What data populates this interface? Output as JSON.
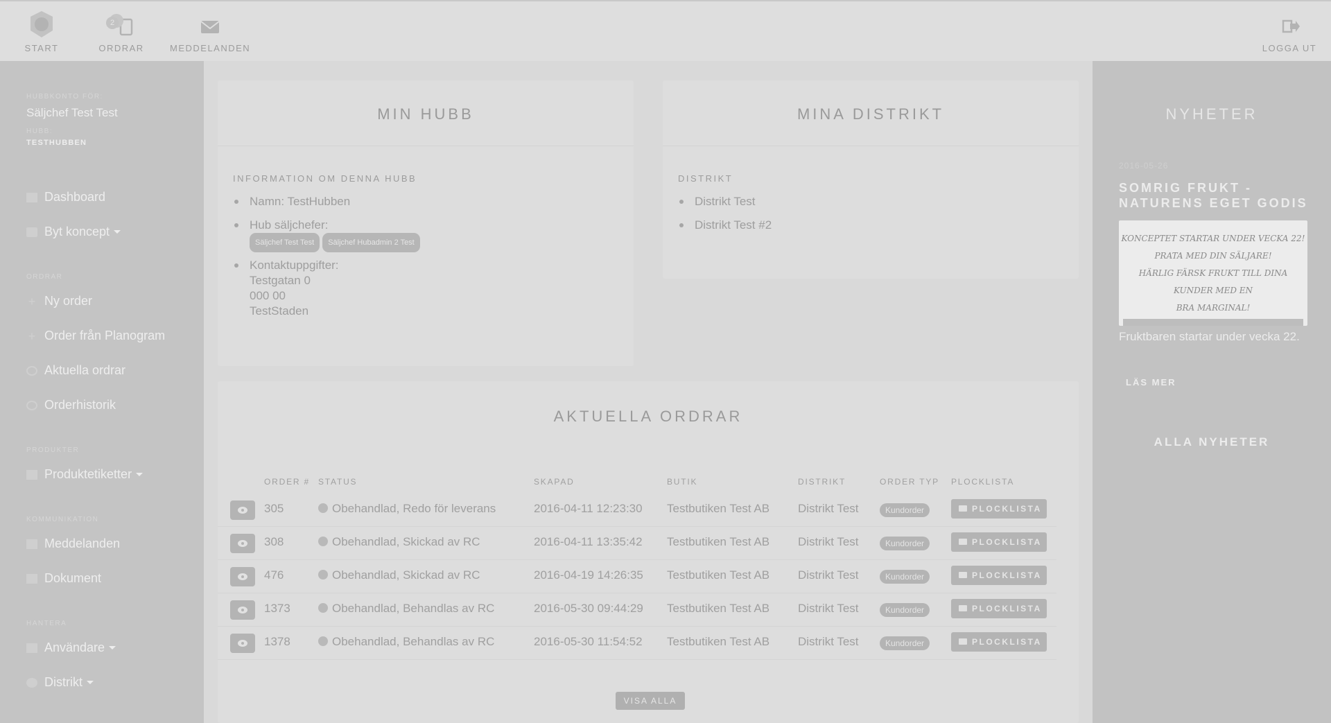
{
  "nav": {
    "start": "START",
    "ordrar": "ORDRAR",
    "ordrar_badge": "2",
    "meddelanden": "MEDDELANDEN",
    "logout": "LOGGA UT"
  },
  "sidebar": {
    "account_label": "HUBBKONTO FÖR:",
    "account_name": "Säljchef Test Test",
    "hub_label": "HUBB:",
    "hub_name": "TESTHUBBEN",
    "items": {
      "dashboard": "Dashboard",
      "byt_koncept": "Byt koncept",
      "section_ordrar": "ORDRAR",
      "ny_order": "Ny order",
      "order_planogram": "Order från Planogram",
      "aktuella": "Aktuella ordrar",
      "historik": "Orderhistorik",
      "section_produkter": "PRODUKTER",
      "produktetiketter": "Produktetiketter",
      "section_kommunikation": "KOMMUNIKATION",
      "meddelanden": "Meddelanden",
      "dokument": "Dokument",
      "section_hantera": "HANTERA",
      "anvandare": "Användare",
      "distrikt": "Distrikt"
    }
  },
  "min_hubb": {
    "title": "MIN HUBB",
    "info_head": "INFORMATION OM DENNA HUBB",
    "namn": "Namn: TestHubben",
    "saljchefer_label": "Hub säljchefer:",
    "saljchefer": [
      "Säljchef Test Test",
      "Säljchef Hubadmin 2 Test"
    ],
    "kontakt_label": "Kontaktuppgifter:",
    "kontakt_street": "Testgatan 0",
    "kontakt_zip": "000 00",
    "kontakt_city": "TestStaden"
  },
  "mina_distrikt": {
    "title": "MINA DISTRIKT",
    "head": "DISTRIKT",
    "items": [
      "Distrikt Test",
      "Distrikt Test #2"
    ]
  },
  "orders": {
    "title": "AKTUELLA ORDRAR",
    "columns": [
      "ORDER #",
      "STATUS",
      "SKAPAD",
      "BUTIK",
      "DISTRIKT",
      "ORDER TYP",
      "PLOCKLISTA"
    ],
    "rows": [
      {
        "id": "305",
        "status": "Obehandlad, Redo för leverans",
        "created": "2016-04-11 12:23:30",
        "store": "Testbutiken Test AB",
        "district": "Distrikt Test",
        "type": "Kundorder",
        "pick": "PLOCKLISTA"
      },
      {
        "id": "308",
        "status": "Obehandlad, Skickad av RC",
        "created": "2016-04-11 13:35:42",
        "store": "Testbutiken Test AB",
        "district": "Distrikt Test",
        "type": "Kundorder",
        "pick": "PLOCKLISTA"
      },
      {
        "id": "476",
        "status": "Obehandlad, Skickad av RC",
        "created": "2016-04-19 14:26:35",
        "store": "Testbutiken Test AB",
        "district": "Distrikt Test",
        "type": "Kundorder",
        "pick": "PLOCKLISTA"
      },
      {
        "id": "1373",
        "status": "Obehandlad, Behandlas av RC",
        "created": "2016-05-30 09:44:29",
        "store": "Testbutiken Test AB",
        "district": "Distrikt Test",
        "type": "Kundorder",
        "pick": "PLOCKLISTA"
      },
      {
        "id": "1378",
        "status": "Obehandlad, Behandlas av RC",
        "created": "2016-05-30 11:54:52",
        "store": "Testbutiken Test AB",
        "district": "Distrikt Test",
        "type": "Kundorder",
        "pick": "PLOCKLISTA"
      }
    ],
    "show_all": "VISA ALLA"
  },
  "news": {
    "title": "NYHETER",
    "date": "2016-05-26",
    "headline": "SOMRIG FRUKT - NATURENS EGET GODIS",
    "image_lines": [
      "KONCEPTET STARTAR UNDER VECKA 22!",
      "PRATA MED DIN SÄLJARE!",
      "HÄRLIG FÄRSK FRUKT TILL DINA KUNDER MED EN",
      "BRA MARGINAL!"
    ],
    "text": "Fruktbaren startar under vecka 22.",
    "read_more": "LÄS MER",
    "all": "ALLA NYHETER"
  }
}
